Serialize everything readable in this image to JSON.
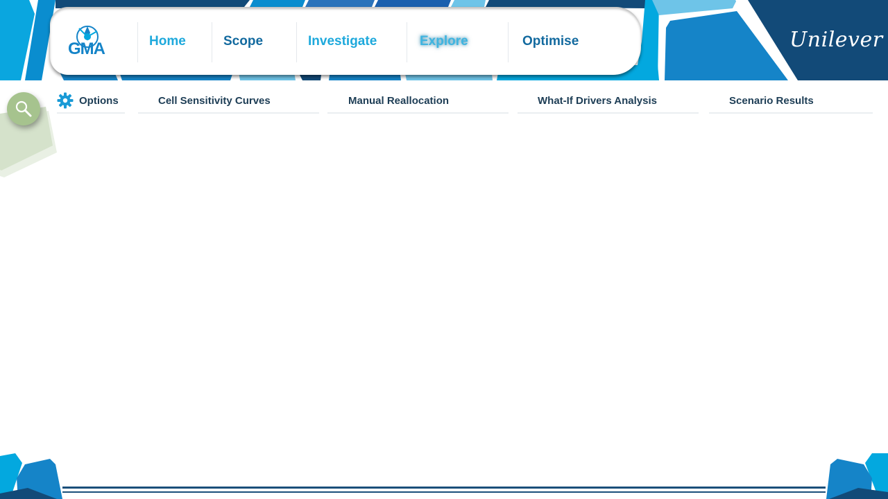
{
  "colors": {
    "dark_blue": "#124a78",
    "mid_blue": "#1584c8",
    "bright_blue": "#03a8df",
    "light_blue": "#6ec4e8",
    "nav_text_light": "#1ea9dc",
    "nav_text_dark": "#136a9f",
    "subtab_text": "#1d3d55",
    "search_green": "#a6c38e"
  },
  "header": {
    "logo_text": "GMA",
    "brand": "Unilever",
    "nav": [
      {
        "label": "Home",
        "active": false
      },
      {
        "label": "Scope",
        "active": false
      },
      {
        "label": "Investigate",
        "active": false
      },
      {
        "label": "Explore",
        "active": true
      },
      {
        "label": "Optimise",
        "active": false
      }
    ]
  },
  "subnav": {
    "options_icon": "gear-icon",
    "options_label": "Options",
    "tabs": [
      {
        "label": "Cell Sensitivity Curves"
      },
      {
        "label": "Manual Reallocation"
      },
      {
        "label": "What-If Drivers Analysis"
      },
      {
        "label": "Scenario Results"
      }
    ]
  },
  "search": {
    "icon": "search-icon"
  }
}
